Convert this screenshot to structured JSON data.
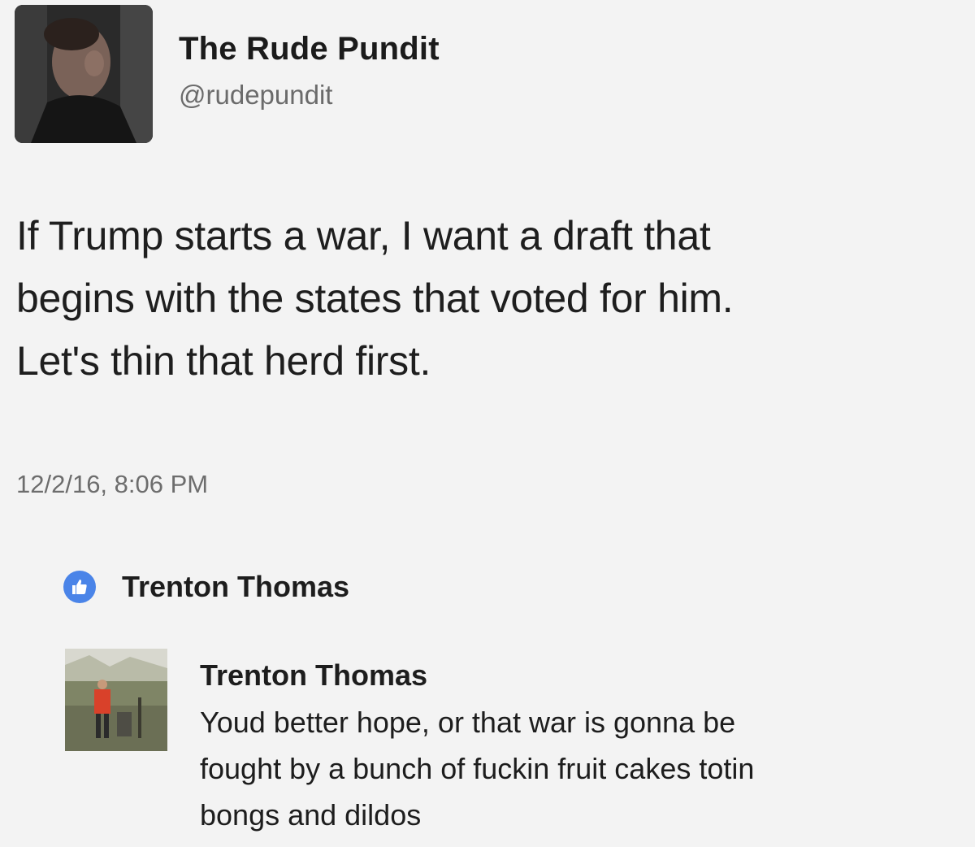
{
  "tweet": {
    "author_name": "The Rude Pundit",
    "author_handle": "@rudepundit",
    "text_lines": [
      "If Trump starts a war, I want a draft that",
      "begins with the states that voted for him.",
      "Let's thin that herd first."
    ],
    "timestamp": "12/2/16, 8:06 PM"
  },
  "reaction": {
    "icon": "thumbs-up-icon",
    "icon_color": "#4a84e8",
    "name": "Trenton Thomas"
  },
  "comment": {
    "author_name": "Trenton Thomas",
    "text_lines": [
      "Youd better hope, or that war is gonna be",
      "fought by a bunch of fuckin fruit cakes totin",
      "bongs and dildos"
    ]
  }
}
